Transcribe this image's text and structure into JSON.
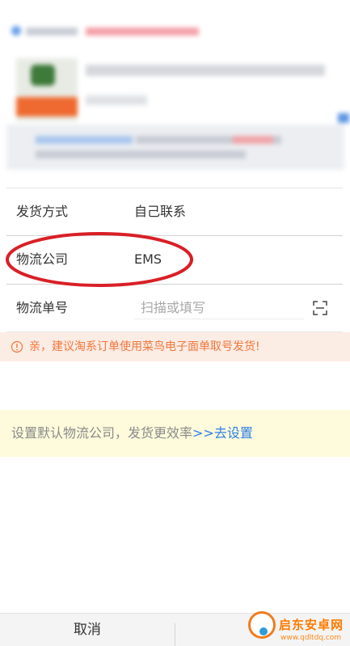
{
  "form": {
    "ship_method": {
      "label": "发货方式",
      "value": "自己联系"
    },
    "logistics_company": {
      "label": "物流公司",
      "value": "EMS"
    },
    "tracking_number": {
      "label": "物流单号",
      "placeholder": "扫描或填写"
    }
  },
  "tip": {
    "text": "亲，建议淘系订单使用菜鸟电子面单取号发货!"
  },
  "promo": {
    "text": "设置默认物流公司，发货更效率",
    "link": ">>去设置"
  },
  "footer": {
    "cancel_label": "取消"
  },
  "watermark": {
    "title": "启东安卓网",
    "url": "www.qdltdq.com"
  },
  "colors": {
    "tip_text": "#f2763b",
    "tip_bg": "#fbece4",
    "promo_bg": "#fdfbdc",
    "link": "#2f7fe6",
    "annotation": "#d91f26"
  },
  "icons": {
    "scan": "scan-icon",
    "tip": "info-circle-icon"
  }
}
